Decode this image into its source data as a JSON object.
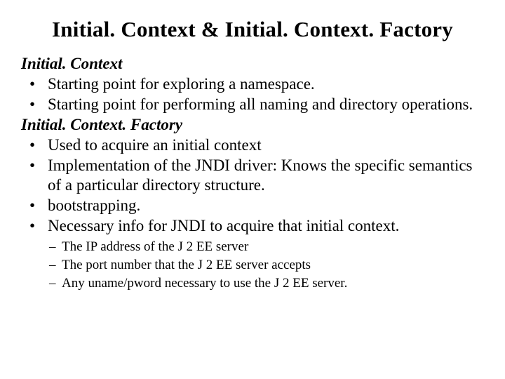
{
  "title": "Initial. Context & Initial. Context. Factory",
  "section1": {
    "heading": "Initial. Context",
    "bullets": [
      "Starting point for exploring a namespace.",
      "Starting point for performing all naming and directory operations."
    ]
  },
  "section2": {
    "heading": "Initial. Context. Factory",
    "bullets": [
      "Used to acquire an initial context",
      "Implementation of the JNDI driver: Knows the specific semantics of a particular directory structure.",
      "bootstrapping.",
      "Necessary info for JNDI to acquire that initial context."
    ],
    "sub": [
      "The IP address of the J 2 EE server",
      "The port number that the J 2 EE server accepts",
      "Any uname/pword necessary to use the J 2 EE server."
    ]
  }
}
